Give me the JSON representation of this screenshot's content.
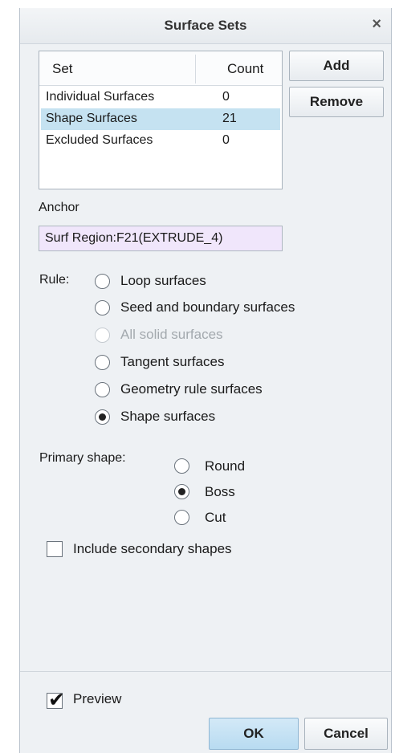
{
  "dialog": {
    "title": "Surface Sets",
    "close_glyph": "×"
  },
  "set_list": {
    "headers": {
      "set": "Set",
      "count": "Count"
    },
    "rows": [
      {
        "name": "Individual Surfaces",
        "count": "0"
      },
      {
        "name": "Shape Surfaces",
        "count": "21"
      },
      {
        "name": "Excluded Surfaces",
        "count": "0"
      }
    ],
    "selected_index": 1
  },
  "buttons": {
    "add": "Add",
    "remove": "Remove",
    "ok": "OK",
    "cancel": "Cancel"
  },
  "anchor": {
    "label": "Anchor",
    "value": "Surf Region:F21(EXTRUDE_4)"
  },
  "rule": {
    "label": "Rule:",
    "options": [
      {
        "label": "Loop surfaces",
        "checked": false,
        "disabled": false
      },
      {
        "label": "Seed and boundary surfaces",
        "checked": false,
        "disabled": false
      },
      {
        "label": "All solid surfaces",
        "checked": false,
        "disabled": true
      },
      {
        "label": "Tangent surfaces",
        "checked": false,
        "disabled": false
      },
      {
        "label": "Geometry rule surfaces",
        "checked": false,
        "disabled": false
      },
      {
        "label": "Shape surfaces",
        "checked": true,
        "disabled": false
      }
    ]
  },
  "primary_shape": {
    "label": "Primary shape:",
    "options": [
      {
        "label": "Round",
        "checked": false
      },
      {
        "label": "Boss",
        "checked": true
      },
      {
        "label": "Cut",
        "checked": false
      }
    ]
  },
  "include_secondary": {
    "label": "Include secondary shapes",
    "checked": false
  },
  "preview": {
    "label": "Preview",
    "checked": true,
    "check_glyph": "✔"
  },
  "colors": {
    "selected_row": "#c5e2f1",
    "anchor_field": "#f0e6fb",
    "primary_button": "#c6e2f5"
  }
}
